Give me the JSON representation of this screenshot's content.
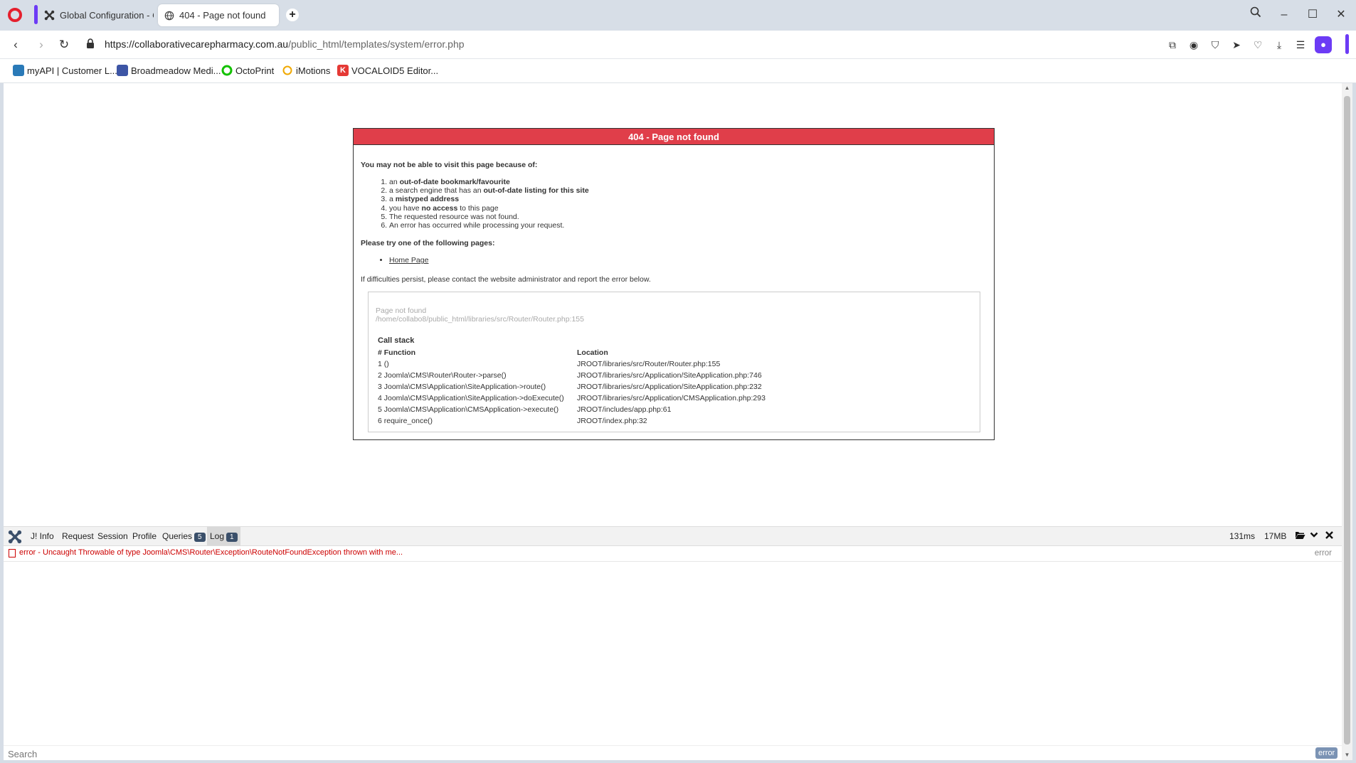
{
  "browser": {
    "tabs": [
      {
        "label": "Global Configuration - Co",
        "icon": "joomla-icon",
        "active": false
      },
      {
        "label": "404 - Page not found",
        "icon": "globe-icon",
        "active": true
      }
    ],
    "url_host": "https://collaborativecarepharmacy.com.au",
    "url_path": "/public_html/templates/system/error.php",
    "bookmarks": [
      {
        "label": "myAPI | Customer L...",
        "icon": "myapi-icon",
        "color": "#2a7ab8"
      },
      {
        "label": "Broadmeadow Medi...",
        "icon": "broadmeadow-icon",
        "color": "#3d55a5"
      },
      {
        "label": "OctoPrint",
        "icon": "octoprint-icon",
        "color": "#13c100"
      },
      {
        "label": "iMotions",
        "icon": "imotions-icon",
        "color": "#f0a800"
      },
      {
        "label": "VOCALOID5 Editor...",
        "icon": "vocaloid-icon",
        "color": "#e53935"
      }
    ],
    "accent_color": "#6c3bf5"
  },
  "error_page": {
    "header": "404 - Page not found",
    "reasons_title": "You may not be able to visit this page because of:",
    "reasons": [
      {
        "pre": "an ",
        "bold": "out-of-date bookmark/favourite",
        "post": ""
      },
      {
        "pre": "a search engine that has an ",
        "bold": "out-of-date listing for this site",
        "post": ""
      },
      {
        "pre": "a ",
        "bold": "mistyped address",
        "post": ""
      },
      {
        "pre": "you have ",
        "bold": "no access",
        "post": " to this page"
      },
      {
        "pre": "The requested resource was not found.",
        "bold": "",
        "post": ""
      },
      {
        "pre": "An error has occurred while processing your request.",
        "bold": "",
        "post": ""
      }
    ],
    "try_title": "Please try one of the following pages:",
    "home_link": "Home Page",
    "persist_note": "If difficulties persist, please contact the website administrator and report the error below.",
    "error_message": "Page not found",
    "error_file": "/home/collabo8/public_html/libraries/src/Router/Router.php:155",
    "callstack_title": "Call stack",
    "callstack_headers": [
      "# Function",
      "Location"
    ],
    "callstack": [
      {
        "fn": "1 ()",
        "loc": "JROOT/libraries/src/Router/Router.php:155"
      },
      {
        "fn": "2 Joomla\\CMS\\Router\\Router->parse()",
        "loc": "JROOT/libraries/src/Application/SiteApplication.php:746"
      },
      {
        "fn": "3 Joomla\\CMS\\Application\\SiteApplication->route()",
        "loc": "JROOT/libraries/src/Application/SiteApplication.php:232"
      },
      {
        "fn": "4 Joomla\\CMS\\Application\\SiteApplication->doExecute()",
        "loc": "JROOT/libraries/src/Application/CMSApplication.php:293"
      },
      {
        "fn": "5 Joomla\\CMS\\Application\\CMSApplication->execute()",
        "loc": "JROOT/includes/app.php:61"
      },
      {
        "fn": "6 require_once()",
        "loc": "JROOT/index.php:32"
      }
    ],
    "header_color": "#e03e4a"
  },
  "debugbar": {
    "tabs": {
      "info": "J! Info",
      "request": "Request",
      "session": "Session",
      "profile": "Profile",
      "queries": "Queries",
      "queries_count": "5",
      "log": "Log",
      "log_count": "1"
    },
    "time": "131ms",
    "memory": "17MB",
    "log_entry": "error - Uncaught Throwable of type Joomla\\CMS\\Router\\Exception\\RouteNotFoundException thrown with me...",
    "log_type": "error",
    "search_placeholder": "Search",
    "filter_label": "error",
    "error_color": "#cc0000"
  }
}
